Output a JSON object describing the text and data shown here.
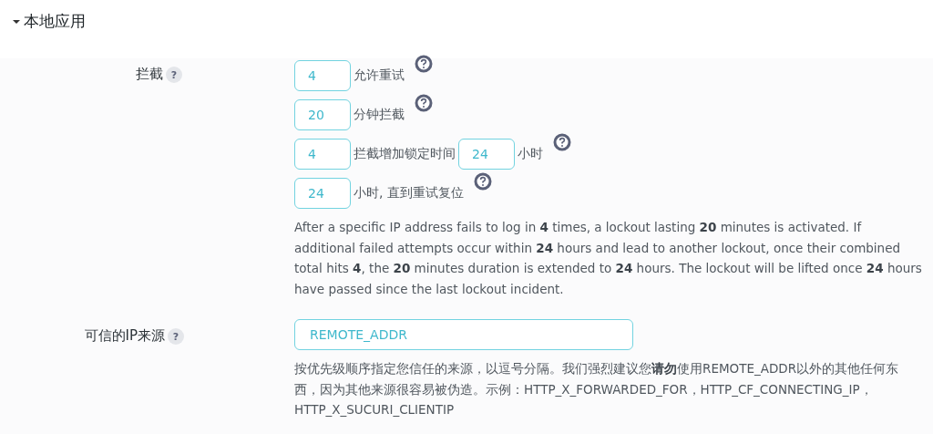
{
  "section": {
    "title": "本地应用",
    "expanded": true
  },
  "lockout": {
    "label": "拦截",
    "help": "?",
    "rows": [
      {
        "parts": [
          {
            "kind": "input",
            "value": "4"
          },
          {
            "kind": "text",
            "text": "允许重试"
          },
          {
            "kind": "help"
          }
        ]
      },
      {
        "parts": [
          {
            "kind": "input",
            "value": "20"
          },
          {
            "kind": "text",
            "text": "分钟拦截"
          },
          {
            "kind": "help"
          }
        ]
      },
      {
        "parts": [
          {
            "kind": "input",
            "value": "4"
          },
          {
            "kind": "text",
            "text": "拦截增加锁定时间"
          },
          {
            "kind": "input",
            "value": "24"
          },
          {
            "kind": "text",
            "text": "小时"
          },
          {
            "kind": "help"
          }
        ]
      },
      {
        "parts": [
          {
            "kind": "input",
            "value": "24"
          },
          {
            "kind": "text",
            "text": "小时, 直到重试复位"
          },
          {
            "kind": "help"
          }
        ]
      }
    ],
    "description": "After a specific IP address fails to log in **4** times, a lockout lasting **20** minutes is activated. If additional failed attempts occur within **24** hours and lead to another lockout, once their combined total hits **4**, the **20** minutes duration is extended to **24** hours. The lockout will be lifted once **24** hours have passed since the last lockout incident."
  },
  "trusted_ip": {
    "label": "可信的IP来源",
    "help": "?",
    "value": "REMOTE_ADDR",
    "description": "按优先级顺序指定您信任的来源，以逗号分隔。我们强烈建议您**请勿**使用REMOTE_ADDR以外的其他任何东西，因为其他来源很容易被伪造。示例：HTTP_X_FORWARDED_FOR，HTTP_CF_CONNECTING_IP，HTTP_X_SUCURI_CLIENTIP"
  }
}
